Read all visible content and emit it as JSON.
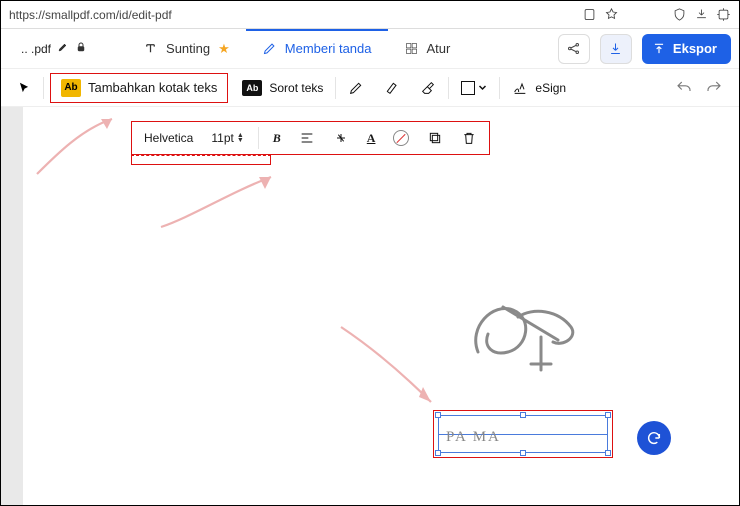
{
  "urlbar": {
    "url": "https://smallpdf.com/id/edit-pdf"
  },
  "file": {
    "name": ".. .pdf"
  },
  "tabs": {
    "edit": "Sunting",
    "annotate": "Memberi tanda",
    "arrange": "Atur"
  },
  "actions": {
    "export": "Ekspor"
  },
  "toolbar": {
    "add_text": "Tambahkan kotak teks",
    "highlight": "Sorot teks",
    "esign": "eSign"
  },
  "text_toolbar": {
    "font": "Helvetica",
    "size": "11pt",
    "bold": "B"
  },
  "canvas": {
    "textbox_value": "PA MA"
  },
  "icons": {
    "cursor": "cursor",
    "share": "share",
    "download": "download",
    "upload": "upload",
    "pencil": "pencil",
    "grid": "grid",
    "star": "star",
    "lock": "lock",
    "pen": "pen",
    "highlighter": "highlighter",
    "eraser": "eraser",
    "square": "square",
    "esign": "esign",
    "undo": "undo",
    "redo": "redo",
    "align": "align",
    "strike": "strike",
    "copy": "copy",
    "trash": "trash",
    "refresh": "refresh",
    "bookmark": "bookmark",
    "puzzle": "puzzle",
    "inbox": "inbox"
  }
}
